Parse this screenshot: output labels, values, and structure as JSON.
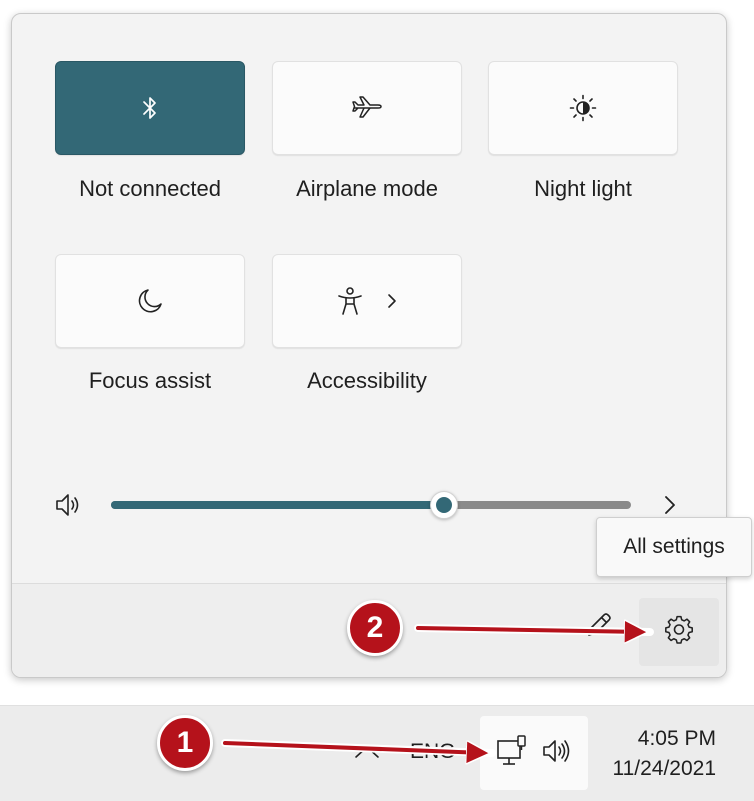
{
  "quick_settings": {
    "tiles": [
      {
        "label": "Not connected",
        "icon": "bluetooth-icon",
        "active": true
      },
      {
        "label": "Airplane mode",
        "icon": "airplane-icon",
        "active": false
      },
      {
        "label": "Night light",
        "icon": "brightness-icon",
        "active": false
      },
      {
        "label": "Focus assist",
        "icon": "moon-icon",
        "active": false
      },
      {
        "label": "Accessibility",
        "icon": "accessibility-icon",
        "active": false
      }
    ],
    "volume": {
      "level_fraction": 0.64,
      "icon": "speaker-icon"
    },
    "footer": {
      "edit_icon": "pencil-icon",
      "settings_icon": "gear-icon"
    },
    "tooltip": "All settings"
  },
  "taskbar": {
    "language": "ENG",
    "time": "4:05 PM",
    "date": "11/24/2021",
    "tray_icons": [
      "network-icon",
      "speaker-icon"
    ]
  },
  "annotations": {
    "badges": [
      "1",
      "2"
    ],
    "arrow_color": "#b5121b"
  },
  "colors": {
    "accent": "#336876",
    "annotation_red": "#b5121b"
  }
}
